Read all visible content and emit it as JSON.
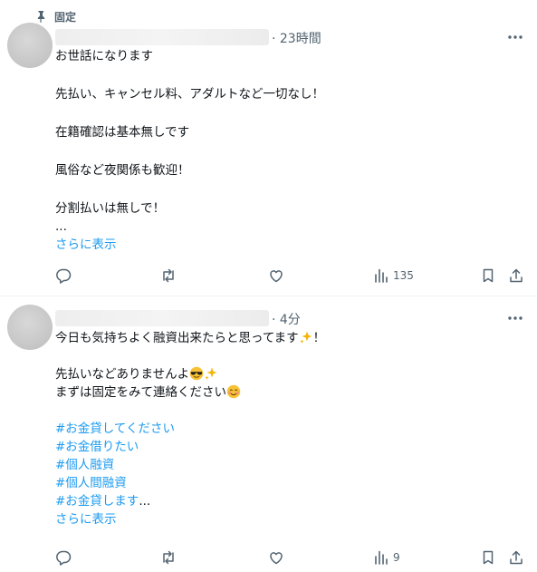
{
  "tweets": [
    {
      "pinned_label": "固定",
      "time": "· 23時間",
      "lines": [
        "お世話になります",
        "",
        "先払い、キャンセル料、アダルトなど一切なし！",
        "",
        "在籍確認は基本無しです",
        "",
        "風俗など夜関係も歓迎！",
        "",
        "分割払いは無しで！",
        "..."
      ],
      "show_more": "さらに表示",
      "views_count": "135"
    },
    {
      "time": "· 4分",
      "line1_a": "今日も気持ちよく融資出来たらと思ってます",
      "line1_b": "！",
      "line3_a": "先払いなどありませんよ",
      "line4_a": "まずは固定をみて連絡ください",
      "hashtags": [
        "#お金貸してください",
        "#お金借りたい",
        "#個人融資",
        "#個人間融資"
      ],
      "last_tag": "#お金貸します",
      "last_tag_suffix": "...",
      "show_more": "さらに表示",
      "views_count": "9"
    }
  ],
  "icons": [
    "pin-icon",
    "more-icon",
    "reply-icon",
    "retweet-icon",
    "like-icon",
    "views-icon",
    "bookmark-icon",
    "share-icon",
    "sparkles-icon",
    "sunglasses-face-icon",
    "smiling-face-icon"
  ],
  "colors": {
    "link": "#1d9bf0",
    "secondary_text": "#536471",
    "text": "#0f1419"
  }
}
